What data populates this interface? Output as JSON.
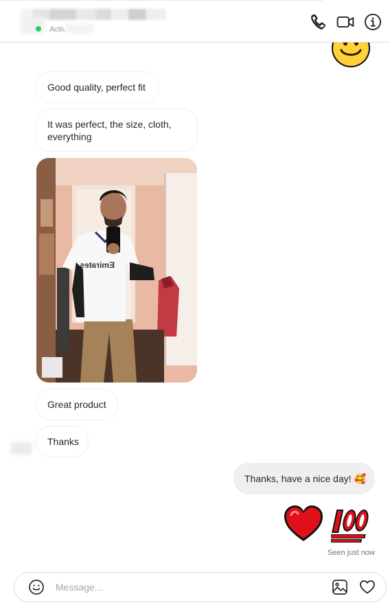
{
  "header": {
    "active_status": "Active"
  },
  "messages": {
    "m1": "Good quality, perfect fit",
    "m2": "It was perfect, the size, cloth, everything",
    "m3": "Great product",
    "m4": "Thanks",
    "reply": "Thanks, have a nice day! 🥰"
  },
  "status": {
    "seen": "Seen just now"
  },
  "composer": {
    "placeholder": "Message..."
  },
  "icons": {
    "call": "phone-icon",
    "video": "video-camera-icon",
    "info": "info-icon",
    "emoji": "smiley-icon",
    "image": "image-icon",
    "like": "heart-icon"
  },
  "colors": {
    "outgoing_bubble": "#efefef",
    "incoming_border": "#efefef",
    "online": "#31c862",
    "heart": "#e0101a",
    "hundred": "#e0101a"
  }
}
